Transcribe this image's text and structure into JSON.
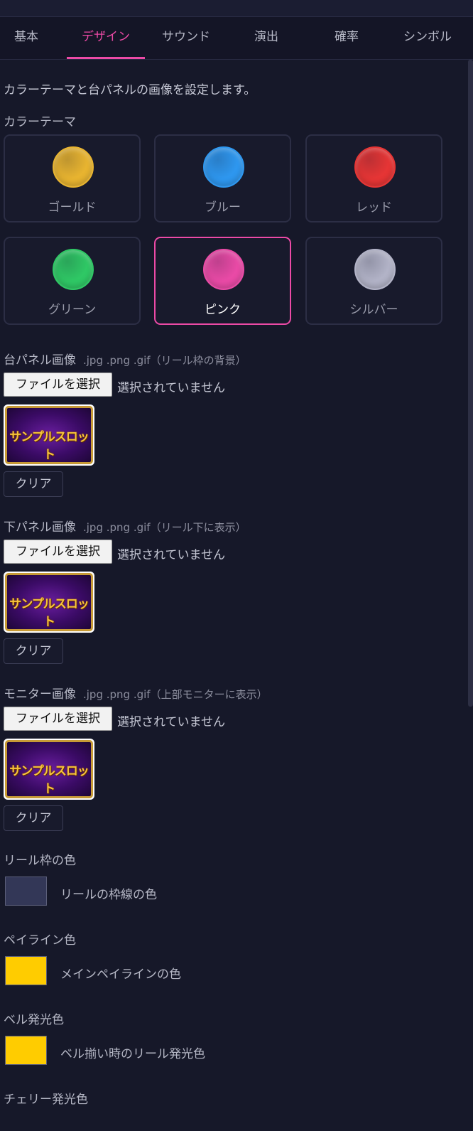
{
  "tabs": [
    "基本",
    "デザイン",
    "サウンド",
    "演出",
    "確率",
    "シンボル"
  ],
  "description": "カラーテーマと台パネルの画像を設定します。",
  "color_theme": {
    "label": "カラーテーマ",
    "options": [
      {
        "name": "ゴールド",
        "color": "#e8b430"
      },
      {
        "name": "ブルー",
        "color": "#2e97ef"
      },
      {
        "name": "レッド",
        "color": "#e63535"
      },
      {
        "name": "グリーン",
        "color": "#2fc865"
      },
      {
        "name": "ピンク",
        "color": "#e94aa6",
        "selected": true
      },
      {
        "name": "シルバー",
        "color": "#b2b3c7"
      }
    ]
  },
  "image_fields": [
    {
      "label": "台パネル画像",
      "hint": ".jpg .png .gif（リール枠の背景）",
      "button": "ファイルを選択",
      "status": "選択されていません",
      "thumb_text": "サンプルスロット",
      "clear": "クリア"
    },
    {
      "label": "下パネル画像",
      "hint": ".jpg .png .gif（リール下に表示）",
      "button": "ファイルを選択",
      "status": "選択されていません",
      "thumb_text": "サンプルスロット",
      "clear": "クリア"
    },
    {
      "label": "モニター画像",
      "hint": ".jpg .png .gif（上部モニターに表示）",
      "button": "ファイルを選択",
      "status": "選択されていません",
      "thumb_text": "サンプルスロット",
      "clear": "クリア"
    }
  ],
  "color_fields": [
    {
      "label": "リール枠の色",
      "value": "#333757",
      "desc": "リールの枠線の色"
    },
    {
      "label": "ペイライン色",
      "value": "#ffcc00",
      "desc": "メインペイラインの色"
    },
    {
      "label": "ベル発光色",
      "value": "#ffcc00",
      "desc": "ベル揃い時のリール発光色"
    },
    {
      "label": "チェリー発光色"
    }
  ]
}
